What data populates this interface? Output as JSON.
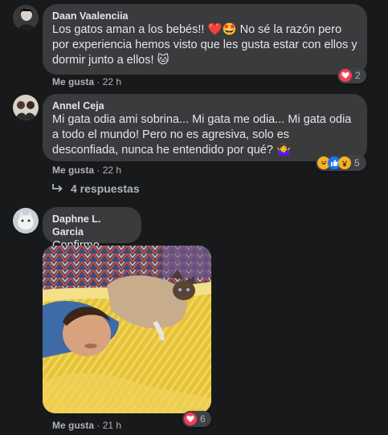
{
  "comments": [
    {
      "author": "Daan Vaalenciia",
      "text": "Los gatos aman a los bebés!! ❤️🤩 No sé la razón pero por experiencia hemos visto que les gusta estar con ellos y dormir junto a ellos! 🐱",
      "like_label": "Me gusta",
      "time": "22 h",
      "reaction_count": "2"
    },
    {
      "author": "Annel Ceja",
      "text": "Mi gata odia ami sobrina... Mi gata me odia... Mi gata odia a todo el mundo! Pero no es agresiva, solo es desconfiada, nunca he entendido por qué? 🤷‍♀️",
      "like_label": "Me gusta",
      "time": "22 h",
      "reaction_count": "5",
      "replies_label": "4 respuestas"
    },
    {
      "author": "Daphne L. Garcia",
      "text": "Confirmo",
      "like_label": "Me gusta",
      "time": "21 h",
      "reaction_count": "6"
    }
  ],
  "separator": "·",
  "colors": {
    "background": "#18191a",
    "bubble": "#3a3b3c",
    "text": "#e4e6eb",
    "muted": "#b0b3b8",
    "love": "#f33e58",
    "like": "#1877f2",
    "haha": "#f7b125"
  },
  "icons": [
    "heart-icon",
    "haha-icon",
    "like-icon",
    "wow-icon",
    "reply-arrow-icon"
  ]
}
